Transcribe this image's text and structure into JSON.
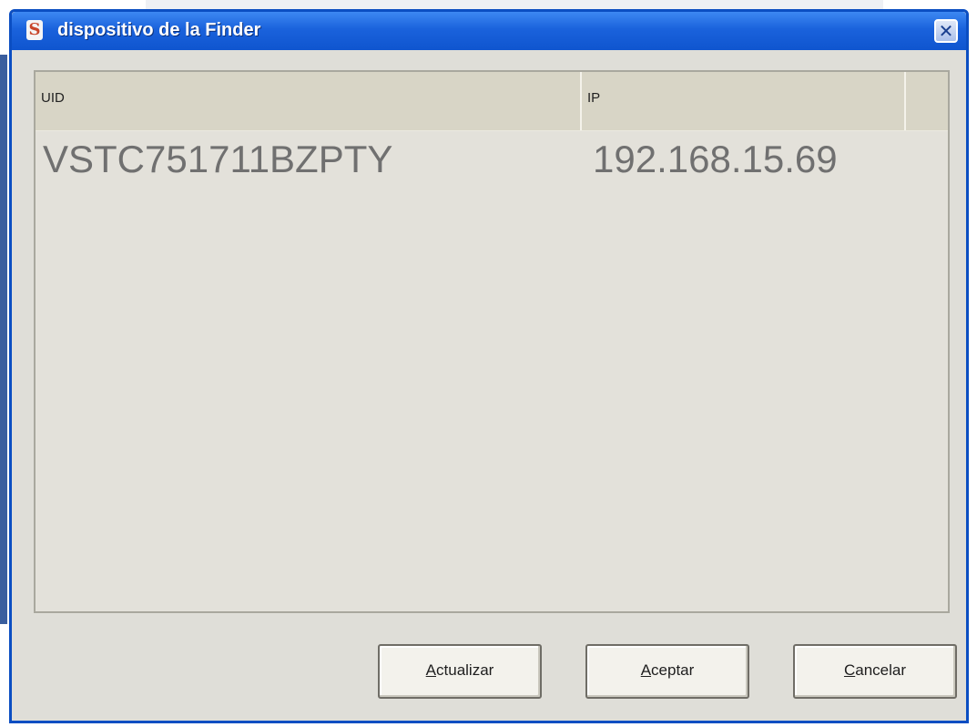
{
  "window": {
    "title": "dispositivo de la Finder",
    "close_glyph": "✕",
    "app_icon": "S"
  },
  "list": {
    "columns": [
      "UID",
      "IP"
    ],
    "rows": [
      {
        "uid": "VSTC751711BZPTY",
        "ip": "192.168.15.69"
      }
    ]
  },
  "buttons": {
    "refresh": {
      "mnemonic": "A",
      "rest": "ctualizar"
    },
    "accept": {
      "mnemonic": "A",
      "rest": "ceptar"
    },
    "cancel": {
      "mnemonic": "C",
      "rest": "ancelar"
    }
  },
  "colors": {
    "titlebar": "#1a62dc",
    "window_bg": "#dfded8",
    "header_bg": "#d8d5c6",
    "cell_text": "#707070"
  }
}
